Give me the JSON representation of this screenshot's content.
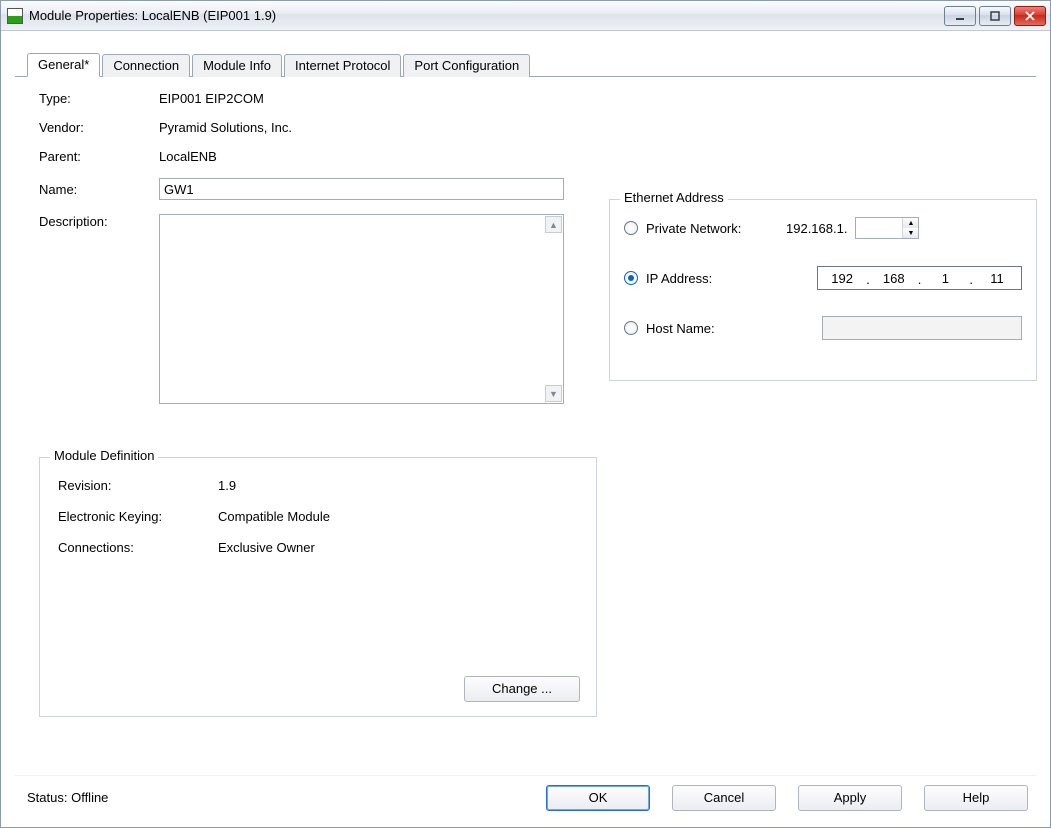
{
  "window": {
    "title": "Module Properties: LocalENB (EIP001 1.9)"
  },
  "tabs": {
    "general": "General*",
    "connection": "Connection",
    "module_info": "Module Info",
    "internet_protocol": "Internet Protocol",
    "port_config": "Port Configuration"
  },
  "labels": {
    "type": "Type:",
    "vendor": "Vendor:",
    "parent": "Parent:",
    "name": "Name:",
    "description": "Description:",
    "ethernet_address": "Ethernet Address",
    "private_network": "Private Network:",
    "ip_address": "IP Address:",
    "host_name": "Host Name:",
    "module_definition": "Module Definition",
    "revision": "Revision:",
    "electronic_keying": "Electronic Keying:",
    "connections": "Connections:",
    "change": "Change ...",
    "status": "Status:  Offline",
    "ok": "OK",
    "cancel": "Cancel",
    "apply": "Apply",
    "help": "Help"
  },
  "values": {
    "type": "EIP001 EIP2COM",
    "vendor": "Pyramid Solutions, Inc.",
    "parent": "LocalENB",
    "name": "GW1",
    "description": "",
    "private_prefix": "192.168.1.",
    "private_last": "",
    "ip_oct1": "192",
    "ip_oct2": "168",
    "ip_oct3": "1",
    "ip_oct4": "11",
    "host_name": "",
    "revision": "1.9",
    "electronic_keying": "Compatible Module",
    "connections": "Exclusive Owner",
    "ethernet_selected": "ip_address"
  }
}
